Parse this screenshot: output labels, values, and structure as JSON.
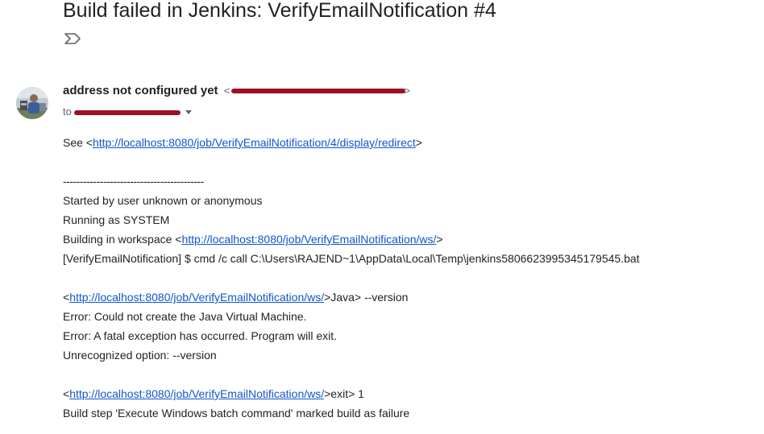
{
  "email": {
    "subject": "Build failed in Jenkins: VerifyEmailNotification #4",
    "label_icon": "label-icon",
    "sender": {
      "name": "address not configured yet",
      "email_open": "<",
      "email_close": ">",
      "avatar_icon": "avatar"
    },
    "recipient": {
      "to_label": "to",
      "caret_icon": "chevron-down-icon"
    },
    "body": {
      "see_prefix": "See <",
      "see_link": "http://localhost:8080/job/VerifyEmailNotification/4/display/redirect",
      "see_suffix": ">",
      "separator": "------------------------------------------",
      "line_started": "Started by user unknown or anonymous",
      "line_running": "Running as SYSTEM",
      "workspace_prefix": "Building in workspace <",
      "workspace_link": "http://localhost:8080/job/VerifyEmailNotification/ws/",
      "workspace_suffix": ">",
      "cmd_line": "[VerifyEmailNotification] $ cmd /c call C:\\Users\\RAJEND~1\\AppData\\Local\\Temp\\jenkins5806623995345179545.bat",
      "java_prefix": "<",
      "java_link": "http://localhost:8080/job/VerifyEmailNotification/ws/",
      "java_suffix": ">Java> --version",
      "error1": "Error: Could not create the Java Virtual Machine.",
      "error2": "Error: A fatal exception has occurred. Program will exit.",
      "unrecognized": "Unrecognized option: --version",
      "exit_prefix": "<",
      "exit_link": "http://localhost:8080/job/VerifyEmailNotification/ws/",
      "exit_suffix": ">exit> 1",
      "build_step": "Build step 'Execute Windows batch command' marked build as failure"
    }
  }
}
